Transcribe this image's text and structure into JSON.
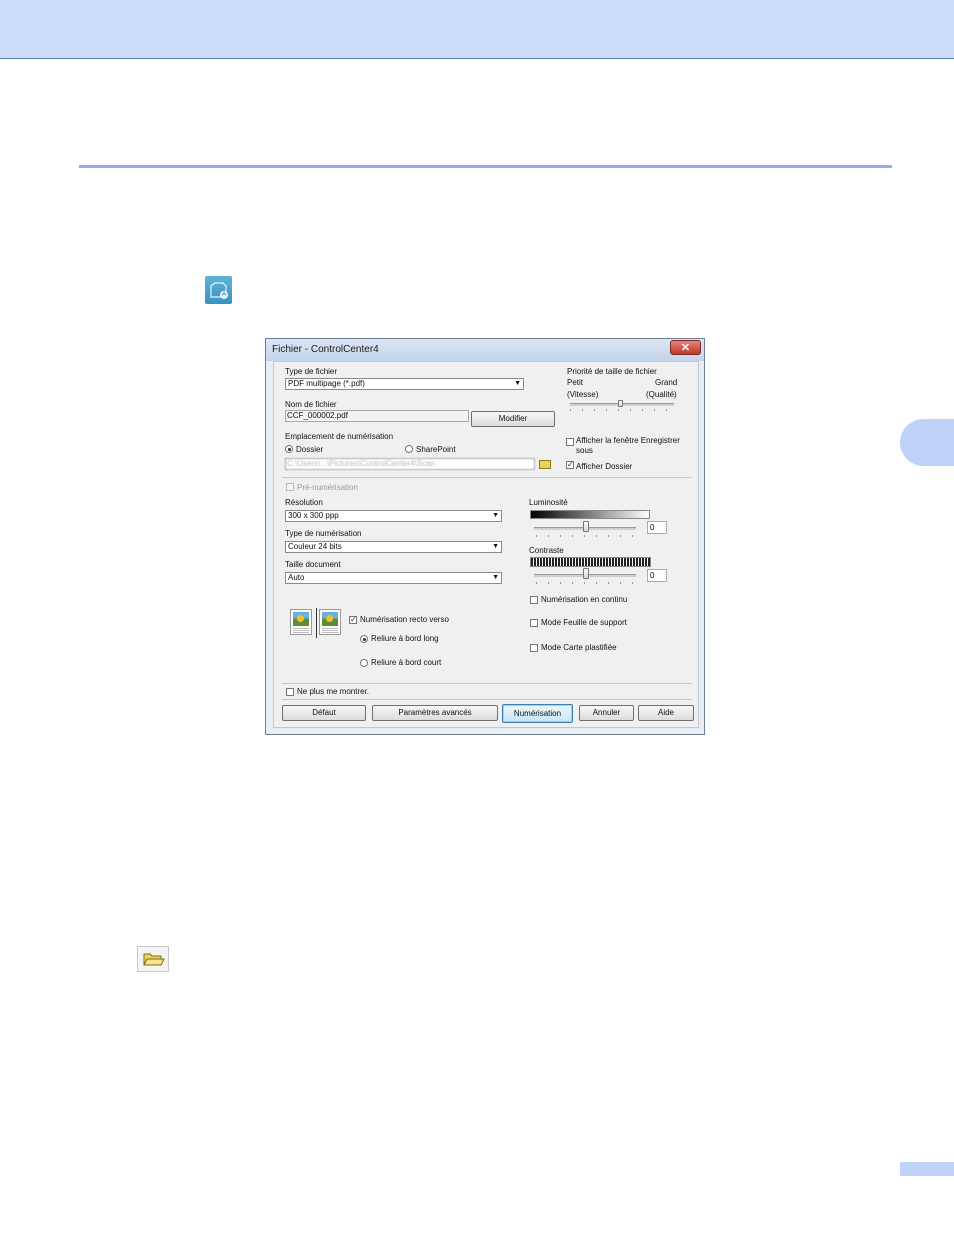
{
  "icons": {
    "scan_icon": "scan-to-file-icon",
    "folder_icon": "folder-open-icon"
  },
  "colors": {
    "header": "#ccdcfb",
    "rule": "#8fb0f0",
    "tab": "#bfd2f8"
  },
  "dialog": {
    "title": "Fichier - ControlCenter4",
    "close": "✕",
    "file_type": {
      "label": "Type de fichier",
      "value": "PDF multipage (*.pdf)"
    },
    "size_priority": {
      "label": "Priorité de taille de fichier",
      "small": "Petit",
      "small_sub": "(Vitesse)",
      "large": "Grand",
      "large_sub": "(Qualité)"
    },
    "file_name": {
      "label": "Nom de fichier",
      "value": "CCF_000002.pdf",
      "modify_button": "Modifier"
    },
    "scan_location": {
      "label": "Emplacement de numérisation",
      "folder": "Dossier",
      "sharepoint": "SharePoint",
      "path": "C:\\Users\\...\\Pictures\\ControlCenter4\\Scan"
    },
    "save_as_window": {
      "label": "Afficher la fenêtre Enregistrer sous",
      "checked": false
    },
    "show_folder": {
      "label": "Afficher Dossier",
      "checked": true
    },
    "prescan": {
      "label": "Pré-numérisation",
      "checked": false
    },
    "resolution": {
      "label": "Résolution",
      "value": "300 x 300 ppp"
    },
    "scan_type": {
      "label": "Type de numérisation",
      "value": "Couleur 24 bits"
    },
    "doc_size": {
      "label": "Taille document",
      "value": "Auto"
    },
    "brightness": {
      "label": "Luminosité",
      "value": "0"
    },
    "contrast": {
      "label": "Contraste",
      "value": "0"
    },
    "duplex": {
      "label": "Numérisation recto verso",
      "checked": true,
      "long_edge": "Reliure à bord long",
      "short_edge": "Reliure à bord court"
    },
    "continuous": {
      "label": "Numérisation en continu",
      "checked": false
    },
    "carrier_sheet": {
      "label": "Mode Feuille de support",
      "checked": false
    },
    "plastic_card": {
      "label": "Mode Carte plastifiée",
      "checked": false
    },
    "dont_show": {
      "label": "Ne plus me montrer.",
      "checked": false
    },
    "buttons": {
      "default": "Défaut",
      "advanced": "Paramètres avancés",
      "scan": "Numérisation",
      "cancel": "Annuler",
      "help": "Aide"
    }
  }
}
